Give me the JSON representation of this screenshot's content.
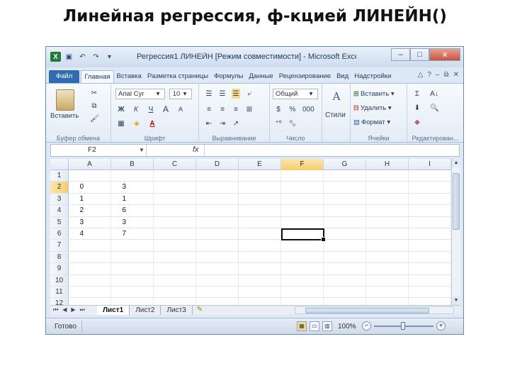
{
  "slide_title": "Линейная регрессия, ф-кцией ЛИНЕЙН()",
  "window": {
    "title": "Регрессия1 ЛИНЕЙН [Режим совместимости] - Microsoft Excel",
    "controls": {
      "minimize": "–",
      "maximize": "□",
      "close": "✕"
    }
  },
  "qat": {
    "logo": "X",
    "save": "▣",
    "undo": "↶",
    "redo": "↷",
    "more": "▾"
  },
  "ribbon_tabs": [
    "Файл",
    "Главная",
    "Вставка",
    "Разметка страницы",
    "Формулы",
    "Данные",
    "Рецензирование",
    "Вид",
    "Надстройки"
  ],
  "ribbon_tab_active": "Главная",
  "ribbon_right_icons": [
    "△",
    "?",
    "–",
    "⧉",
    "✕"
  ],
  "ribbon": {
    "clipboard": {
      "label": "Буфер обмена",
      "paste": "Вставить",
      "cut": "✂",
      "copy": "⧉",
      "format_painter": "🖌"
    },
    "font": {
      "label": "Шрифт",
      "name": "Arial Cyr",
      "size": "10",
      "bold": "Ж",
      "italic": "К",
      "underline": "Ч",
      "grow": "A",
      "shrink": "A",
      "borders": "▦",
      "fill": "◈",
      "color": "A"
    },
    "alignment": {
      "label": "Выравнивание",
      "wrap": "⤶",
      "merge": "⊞"
    },
    "number": {
      "label": "Число",
      "format": "Общий",
      "currency": "$",
      "percent": "%",
      "thousands": "000"
    },
    "styles": {
      "label": "",
      "name": "Стили"
    },
    "cells": {
      "label": "Ячейки",
      "insert": "Вставить",
      "delete": "Удалить",
      "format": "Формат"
    },
    "editing": {
      "label": "Редактирован...",
      "sum": "Σ",
      "fill": "⬇",
      "clear": "◆",
      "sort": "A↓",
      "find": "🔍"
    }
  },
  "formula_bar": {
    "namebox": "F2",
    "fx": "fx",
    "formula": ""
  },
  "columns": [
    "A",
    "B",
    "C",
    "D",
    "E",
    "F",
    "G",
    "H",
    "I"
  ],
  "selected_column": "F",
  "rows": [
    {
      "num": "1",
      "A": "",
      "B": ""
    },
    {
      "num": "2",
      "A": "0",
      "B": "3"
    },
    {
      "num": "3",
      "A": "1",
      "B": "1"
    },
    {
      "num": "4",
      "A": "2",
      "B": "6"
    },
    {
      "num": "5",
      "A": "3",
      "B": "3"
    },
    {
      "num": "6",
      "A": "4",
      "B": "7"
    },
    {
      "num": "7",
      "A": "",
      "B": ""
    },
    {
      "num": "8",
      "A": "",
      "B": ""
    },
    {
      "num": "9",
      "A": "",
      "B": ""
    },
    {
      "num": "10",
      "A": "",
      "B": ""
    },
    {
      "num": "11",
      "A": "",
      "B": ""
    },
    {
      "num": "12",
      "A": "",
      "B": ""
    }
  ],
  "selected_row": "2",
  "sheet_tabs": [
    "Лист1",
    "Лист2",
    "Лист3"
  ],
  "active_sheet": "Лист1",
  "status": {
    "text": "Готово",
    "zoom": "100%"
  }
}
